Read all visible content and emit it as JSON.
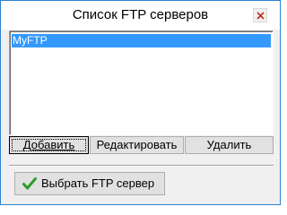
{
  "window": {
    "title": "Список FTP серверов"
  },
  "servers": {
    "items": [
      "MyFTP"
    ],
    "selected_index": 0
  },
  "buttons": {
    "add_label": "Добавить",
    "edit_label": "Редактировать",
    "delete_label": "Удалить",
    "select_label": "Выбрать FTP сервер"
  },
  "icons": {
    "close": "close-icon",
    "select": "checkmark-icon"
  },
  "colors": {
    "selection": "#3399ff",
    "check": "#2a9d2a",
    "close_x": "#c42b1c"
  }
}
